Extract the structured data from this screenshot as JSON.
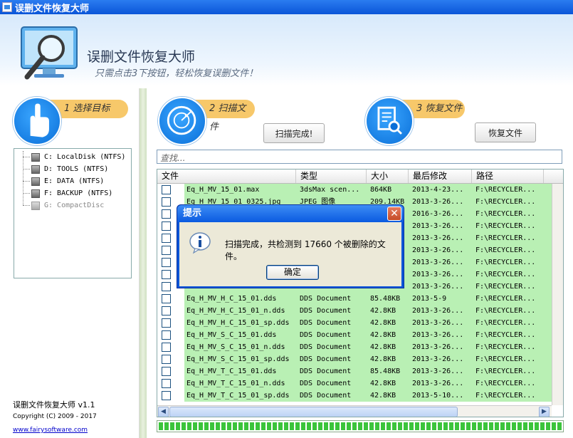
{
  "window": {
    "title": "误删文件恢复大师"
  },
  "header": {
    "app_name": "误删文件恢复大师",
    "slogan": "只需点击3下按钮，轻松恢复误删文件！"
  },
  "steps": [
    {
      "label": "1 选择目标"
    },
    {
      "label": "2 扫描文件"
    },
    {
      "label": "3 恢复文件"
    }
  ],
  "drives": [
    {
      "label": "C: LocalDisk (NTFS)"
    },
    {
      "label": "D: TOOLS (NTFS)"
    },
    {
      "label": "E: DATA (NTFS)"
    },
    {
      "label": "F: BACKUP (NTFS)"
    },
    {
      "label": "G: CompactDisc"
    }
  ],
  "buttons": {
    "scan": "扫描完成!",
    "recover": "恢复文件"
  },
  "search": {
    "placeholder": "查找..."
  },
  "columns": [
    "文件",
    "类型",
    "大小",
    "最后修改",
    "路径"
  ],
  "rows": [
    {
      "name": "Eq_H_MV_15_01.max",
      "type": "3dsMax scen...",
      "size": "864KB",
      "date": "2013-4-23...",
      "path": "F:\\RECYCLER..."
    },
    {
      "name": "Eq_H_MV_15_01_0325.jpg",
      "type": "JPEG 图像",
      "size": "209.14KB",
      "date": "2013-3-26...",
      "path": "F:\\RECYCLER..."
    },
    {
      "name": "",
      "type": "",
      "size": "",
      "date": "2016-3-26...",
      "path": "F:\\RECYCLER..."
    },
    {
      "name": "",
      "type": "",
      "size": "",
      "date": "2013-3-26...",
      "path": "F:\\RECYCLER..."
    },
    {
      "name": "",
      "type": "",
      "size": "",
      "date": "2013-3-26...",
      "path": "F:\\RECYCLER..."
    },
    {
      "name": "",
      "type": "",
      "size": "",
      "date": "2013-3-26...",
      "path": "F:\\RECYCLER..."
    },
    {
      "name": "",
      "type": "",
      "size": "",
      "date": "2013-3-26...",
      "path": "F:\\RECYCLER..."
    },
    {
      "name": "",
      "type": "",
      "size": "",
      "date": "2013-3-26...",
      "path": "F:\\RECYCLER..."
    },
    {
      "name": "",
      "type": "DDS Document",
      "size": "",
      "date": "2013-3-26...",
      "path": "F:\\RECYCLER..."
    },
    {
      "name": "Eq_H_MV_H_C_15_01.dds",
      "type": "DDS Document",
      "size": "85.48KB",
      "date": "2013-5-9",
      "path": "F:\\RECYCLER..."
    },
    {
      "name": "Eq_H_MV_H_C_15_01_n.dds",
      "type": "DDS Document",
      "size": "42.8KB",
      "date": "2013-3-26...",
      "path": "F:\\RECYCLER..."
    },
    {
      "name": "Eq_H_MV_H_C_15_01_sp.dds",
      "type": "DDS Document",
      "size": "42.8KB",
      "date": "2013-3-26...",
      "path": "F:\\RECYCLER..."
    },
    {
      "name": "Eq_H_MV_S_C_15_01.dds",
      "type": "DDS Document",
      "size": "42.8KB",
      "date": "2013-3-26...",
      "path": "F:\\RECYCLER..."
    },
    {
      "name": "Eq_H_MV_S_C_15_01_n.dds",
      "type": "DDS Document",
      "size": "42.8KB",
      "date": "2013-3-26...",
      "path": "F:\\RECYCLER..."
    },
    {
      "name": "Eq_H_MV_S_C_15_01_sp.dds",
      "type": "DDS Document",
      "size": "42.8KB",
      "date": "2013-3-26...",
      "path": "F:\\RECYCLER..."
    },
    {
      "name": "Eq_H_MV_T_C_15_01.dds",
      "type": "DDS Document",
      "size": "85.48KB",
      "date": "2013-3-26...",
      "path": "F:\\RECYCLER..."
    },
    {
      "name": "Eq_H_MV_T_C_15_01_n.dds",
      "type": "DDS Document",
      "size": "42.8KB",
      "date": "2013-3-26...",
      "path": "F:\\RECYCLER..."
    },
    {
      "name": "Eq_H_MV_T_C_15_01_sp.dds",
      "type": "DDS Document",
      "size": "42.8KB",
      "date": "2013-5-10...",
      "path": "F:\\RECYCLER..."
    }
  ],
  "footer": {
    "product": "误删文件恢复大师 v1.1",
    "copyright": "Copyright (C) 2009 - 2017",
    "website": "www.fairysoftware.com"
  },
  "dialog": {
    "title": "提示",
    "message": "扫描完成，共检测到 17660 个被删除的文件。",
    "ok": "确定"
  },
  "colors": {
    "accent": "#0a55d8",
    "row_highlight": "#b9f0b4",
    "progress": "#3bc43b",
    "tag": "#f7c86a"
  }
}
